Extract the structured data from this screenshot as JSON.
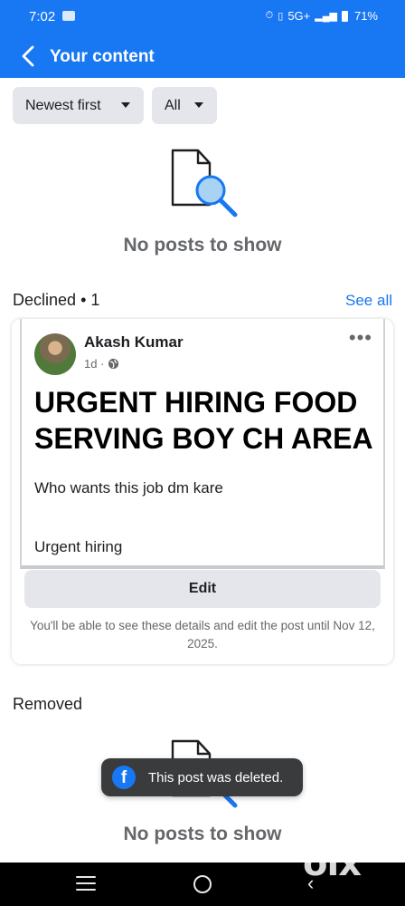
{
  "status_bar": {
    "time": "7:02",
    "network": "5G+",
    "battery": "71%"
  },
  "header": {
    "title": "Your content"
  },
  "filters": {
    "sort_label": "Newest first",
    "type_label": "All"
  },
  "top_empty": {
    "text": "No posts to show",
    "icon": "document-search-icon"
  },
  "declined": {
    "title": "Declined",
    "count": "• 1",
    "see_all": "See all"
  },
  "post": {
    "author": "Akash Kumar",
    "time": "1d ·",
    "heading": "URGENT HIRING FOOD SERVING BOY CH AREA",
    "body_line1": "Who wants this job dm kare",
    "body_line2": "Urgent hiring",
    "edit_label": "Edit",
    "edit_note": "You'll be able to see these details and edit the post until Nov 12, 2025."
  },
  "removed": {
    "title": "Removed"
  },
  "bottom_empty": {
    "text": "No posts to show",
    "icon": "document-search-icon"
  },
  "toast": {
    "text": "This post was deleted.",
    "icon": "facebook-icon"
  },
  "watermark": {
    "text": "olx"
  },
  "colors": {
    "brand": "#1877f2",
    "button_bg": "#e4e6eb",
    "toast_bg": "#3a3b3c",
    "muted_text": "#65676b"
  }
}
